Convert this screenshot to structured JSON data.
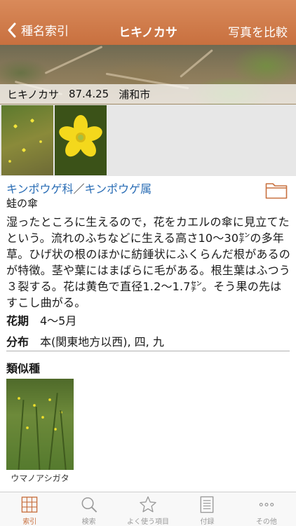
{
  "navbar": {
    "back_label": "種名索引",
    "title": "ヒキノカサ",
    "right_label": "写真を比較"
  },
  "photo": {
    "caption_name": "ヒキノカサ",
    "caption_date": "87.4.25",
    "caption_place": "浦和市"
  },
  "taxonomy": {
    "family": "キンポウゲ科",
    "separator": "／",
    "genus": "キンポウゲ属",
    "kanji_name": "蛙の傘"
  },
  "description": "湿ったところに生えるので，花をカエルの傘に見立てたという。流れのふちなどに生える高さ10～30㌢の多年草。ひげ状の根のほかに紡錘状にふくらんだ根があるのが特徴。茎や葉にはまばらに毛がある。根生葉はふつう３裂する。花は黄色で直径1.2～1.7㌢。そう果の先はすこし曲がる。",
  "fields": {
    "flowering_label": "花期",
    "flowering_value": "4～5月",
    "distribution_label": "分布",
    "distribution_value": "本(関東地方以西), 四, 九"
  },
  "similar": {
    "heading": "類似種",
    "items": [
      {
        "name": "ウマノアシガタ"
      }
    ]
  },
  "tabs": [
    {
      "label": "索引",
      "icon": "grid-icon",
      "active": true
    },
    {
      "label": "検索",
      "icon": "search-icon",
      "active": false
    },
    {
      "label": "よく使う項目",
      "icon": "star-icon",
      "active": false
    },
    {
      "label": "付録",
      "icon": "document-icon",
      "active": false
    },
    {
      "label": "その他",
      "icon": "more-icon",
      "active": false
    }
  ],
  "colors": {
    "navbar": "#c8703f",
    "accent": "#c8703f",
    "link": "#2a6db5",
    "flower_yellow": "#f4d81c"
  }
}
